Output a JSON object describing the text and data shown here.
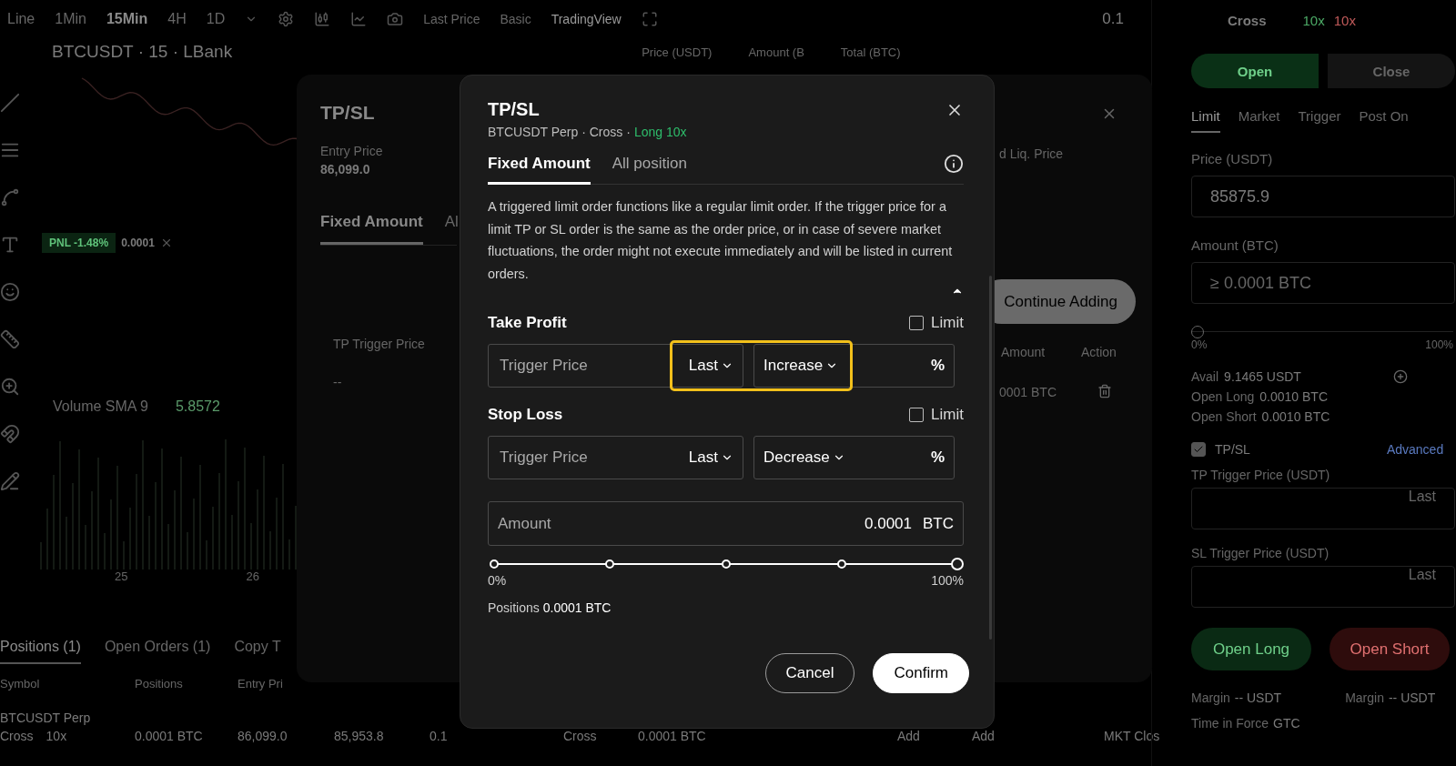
{
  "top_bar": {
    "timeframes": [
      {
        "label": "Line",
        "selected": false
      },
      {
        "label": "1Min",
        "selected": false
      },
      {
        "label": "15Min",
        "selected": true
      },
      {
        "label": "4H",
        "selected": false
      },
      {
        "label": "1D",
        "selected": false
      }
    ],
    "price_source": "Last Price",
    "views": [
      {
        "label": "Basic",
        "selected": false
      },
      {
        "label": "TradingView",
        "selected": true
      }
    ],
    "precision": "0.1"
  },
  "chart": {
    "symbol": "BTCUSDT · 15 · LBank",
    "pnl": "PNL -1.48%",
    "pnl_amount": "0.0001",
    "volume_label": "Volume SMA 9",
    "volume_value": "5.8572",
    "x_labels": [
      "25",
      "26"
    ]
  },
  "order_book": {
    "columns": [
      "Price (USDT)",
      "Amount (B",
      "Total (BTC)"
    ]
  },
  "positions_panel": {
    "tabs": [
      {
        "label": "Positions (1)",
        "selected": true
      },
      {
        "label": "Open Orders (1)",
        "selected": false
      },
      {
        "label": "Copy T",
        "selected": false
      }
    ],
    "columns": [
      "Symbol",
      "Positions",
      "Entry Pri"
    ],
    "row": {
      "symbol": "BTCUSDT Perp",
      "margin_mode": "Cross",
      "leverage": "10x",
      "cells": [
        "0.0001 BTC",
        "86,099.0",
        "85,953.8",
        "0.1",
        "Cross",
        "0.0001 BTC",
        "Add",
        "Add",
        "MKT Clos"
      ]
    }
  },
  "order_panel": {
    "margin_mode": "Cross",
    "leverage_long": "10x",
    "leverage_short": "10x",
    "sides": [
      {
        "label": "Open",
        "selected": true
      },
      {
        "label": "Close",
        "selected": false
      }
    ],
    "order_types": [
      {
        "label": "Limit",
        "selected": true
      },
      {
        "label": "Market",
        "selected": false
      },
      {
        "label": "Trigger",
        "selected": false
      },
      {
        "label": "Post On",
        "selected": false
      }
    ],
    "price_label": "Price (USDT)",
    "price_value": "85875.9",
    "amount_label": "Amount (BTC)",
    "amount_placeholder": "≥ 0.0001 BTC",
    "slider": {
      "level": 0,
      "min_label": "0%",
      "max_label": "100%"
    },
    "stats": [
      {
        "label": "Avail",
        "value": "9.1465 USDT"
      },
      {
        "label": "Open Long",
        "value": "0.0010 BTC"
      },
      {
        "label": "Open Short",
        "value": "0.0010 BTC"
      }
    ],
    "tpsl": {
      "label": "TP/SL",
      "checked": true,
      "advanced": "Advanced"
    },
    "triggers": [
      {
        "label": "TP Trigger Price (USDT)",
        "source": "Last"
      },
      {
        "label": "SL Trigger Price (USDT)",
        "source": "Last"
      }
    ],
    "buttons": [
      {
        "label": "Open Long",
        "kind": "long"
      },
      {
        "label": "Open Short",
        "kind": "short"
      }
    ],
    "margins": [
      {
        "label": "Margin",
        "value": "-- USDT"
      },
      {
        "label": "Margin",
        "value": "-- USDT"
      }
    ],
    "time_in_force": {
      "label": "Time in Force",
      "value": "GTC"
    }
  },
  "background_dialog": {
    "title": "TP/SL",
    "entry_label": "Entry Price",
    "entry_value": "86,099.0",
    "tabs": [
      {
        "label": "Fixed Amount",
        "selected": true
      },
      {
        "label": "Al",
        "selected": false
      }
    ],
    "liq_label": "d Liq. Price",
    "continue_button": "Continue Adding",
    "columns": [
      "TP Trigger Price",
      "Amount",
      "Action"
    ],
    "row": {
      "trigger": "--",
      "amount": "0001 BTC"
    }
  },
  "dialog": {
    "title": "TP/SL",
    "instrument": "BTCUSDT Perp · Cross ·",
    "position": "Long 10x",
    "tabs": [
      {
        "label": "Fixed Amount",
        "selected": true
      },
      {
        "label": "All position",
        "selected": false
      }
    ],
    "notice": "A triggered limit order functions like a regular limit order. If the trigger price for a limit TP or SL order is the same as the order price, or in case of severe market fluctuations, the order might not execute immediately and will be listed in current orders.",
    "notice_expanded": true,
    "sections": [
      {
        "title": "Take Profit",
        "limit_label": "Limit",
        "limit_checked": false,
        "placeholder": "Trigger Price",
        "source": "Last",
        "change": "Increase",
        "unit": "%",
        "highlighted": true
      },
      {
        "title": "Stop Loss",
        "limit_label": "Limit",
        "limit_checked": false,
        "placeholder": "Trigger Price",
        "source": "Last",
        "change": "Decrease",
        "unit": "%",
        "highlighted": false
      }
    ],
    "amount": {
      "label": "Amount",
      "value": "0.0001",
      "unit": "BTC"
    },
    "slider": {
      "level": 1,
      "min_label": "0%",
      "max_label": "100%"
    },
    "positions_label": "Positions",
    "positions_value": "0.0001 BTC",
    "buttons": [
      {
        "label": "Cancel",
        "kind": "secondary"
      },
      {
        "label": "Confirm",
        "kind": "primary"
      }
    ]
  }
}
